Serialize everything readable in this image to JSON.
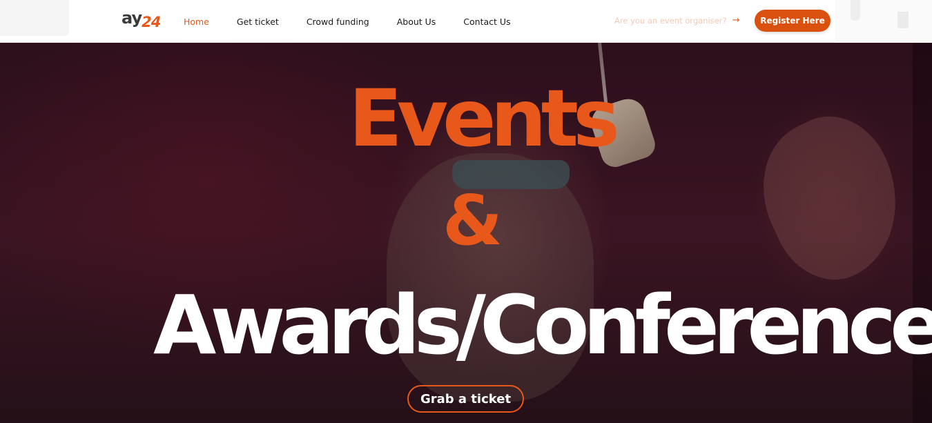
{
  "header": {
    "logo": {
      "part1": "ay",
      "part2": "24"
    },
    "nav": [
      {
        "label": "Home",
        "active": true
      },
      {
        "label": "Get ticket",
        "active": false
      },
      {
        "label": "Crowd funding",
        "active": false
      },
      {
        "label": "About Us",
        "active": false
      },
      {
        "label": "Contact Us",
        "active": false
      }
    ],
    "organiser_link": "Are you an event organiser?",
    "organiser_arrow_icon": "arrow-right-icon",
    "register_label": "Register Here"
  },
  "hero": {
    "title_line1": "Events",
    "title_line2": "&",
    "title_line3": "Awards/Conferences",
    "cta_label": "Grab a ticket"
  },
  "colors": {
    "accent": "#e8581a",
    "register_button": "#d9500f",
    "hero_background": "#2d0f1c",
    "hero_text": "#ffffff"
  }
}
